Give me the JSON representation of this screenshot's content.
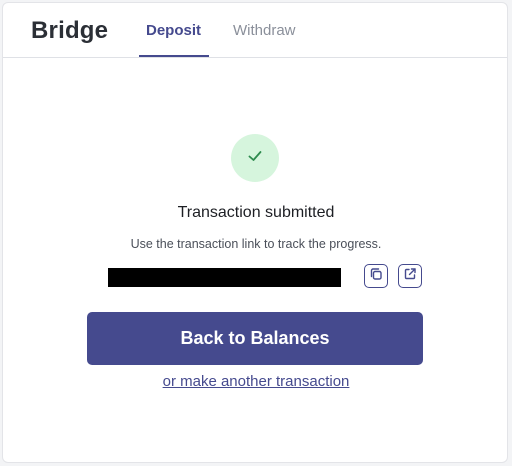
{
  "header": {
    "brand": "Bridge",
    "tabs": [
      {
        "label": "Deposit",
        "active": true
      },
      {
        "label": "Withdraw",
        "active": false
      }
    ]
  },
  "status": {
    "icon": "checkmark-icon",
    "title": "Transaction submitted",
    "subtitle": "Use the transaction link to track the progress."
  },
  "transaction": {
    "hash_redacted": true,
    "copy_icon": "copy-icon",
    "open_icon": "external-link-icon"
  },
  "actions": {
    "primary_label": "Back to Balances",
    "secondary_label": "or make another transaction"
  },
  "colors": {
    "accent": "#454a8e",
    "success_bg": "#d6f5dd",
    "success_icon": "#2e8b4e"
  }
}
